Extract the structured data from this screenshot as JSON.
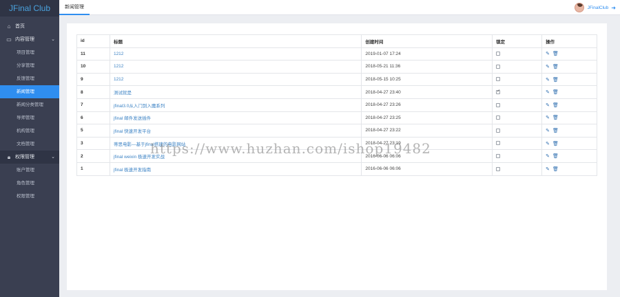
{
  "sidebar": {
    "brand": "JFinal Club",
    "home": {
      "label": "首页",
      "icon": "home-icon"
    },
    "content_group": {
      "label": "内容管理",
      "icon": "document-icon",
      "items": [
        "项目管理",
        "分享管理",
        "反馈管理",
        "新闻管理",
        "新闻分类管理",
        "导师管理",
        "机构管理",
        "文档管理"
      ],
      "active": "新闻管理"
    },
    "permission_group": {
      "label": "权限管理",
      "icon": "lock-icon",
      "items": [
        "账户管理",
        "角色管理",
        "权限管理"
      ]
    }
  },
  "header": {
    "tab": "新闻管理",
    "username": "JFinalClub"
  },
  "table": {
    "columns": [
      "id",
      "标题",
      "创建时间",
      "锁定",
      "操作"
    ],
    "rows": [
      {
        "id": "11",
        "title": "1212",
        "created": "2019-01-07 17:24",
        "locked": false
      },
      {
        "id": "10",
        "title": "1212",
        "created": "2018-05-21 11:36",
        "locked": false
      },
      {
        "id": "9",
        "title": "1212",
        "created": "2018-05-15 10:25",
        "locked": false
      },
      {
        "id": "8",
        "title": "测试就是",
        "created": "2018-04-27 23:40",
        "locked": true
      },
      {
        "id": "7",
        "title": "jfinal3.0从入门到入魔系列",
        "created": "2018-04-27 23:26",
        "locked": false
      },
      {
        "id": "6",
        "title": "jfinal 邮件发送插件",
        "created": "2018-04-27 23:25",
        "locked": false
      },
      {
        "id": "5",
        "title": "jfinal 快速开发平台",
        "created": "2018-04-27 23:22",
        "locked": false
      },
      {
        "id": "3",
        "title": "蒂思电影—基于jfinal搭建的电影网站",
        "created": "2018-04-27 23:19",
        "locked": false
      },
      {
        "id": "2",
        "title": "jfinal weixin 极速开发实战",
        "created": "2016-06-06 06:06",
        "locked": false
      },
      {
        "id": "1",
        "title": "jfinal 极速开发指南",
        "created": "2016-06-06 06:06",
        "locked": false
      }
    ]
  },
  "watermark": "https://www.huzhan.com/ishop19482",
  "colors": {
    "accent": "#2f8ef0",
    "sidebar": "#3a3f51",
    "link": "#3b82c4"
  }
}
